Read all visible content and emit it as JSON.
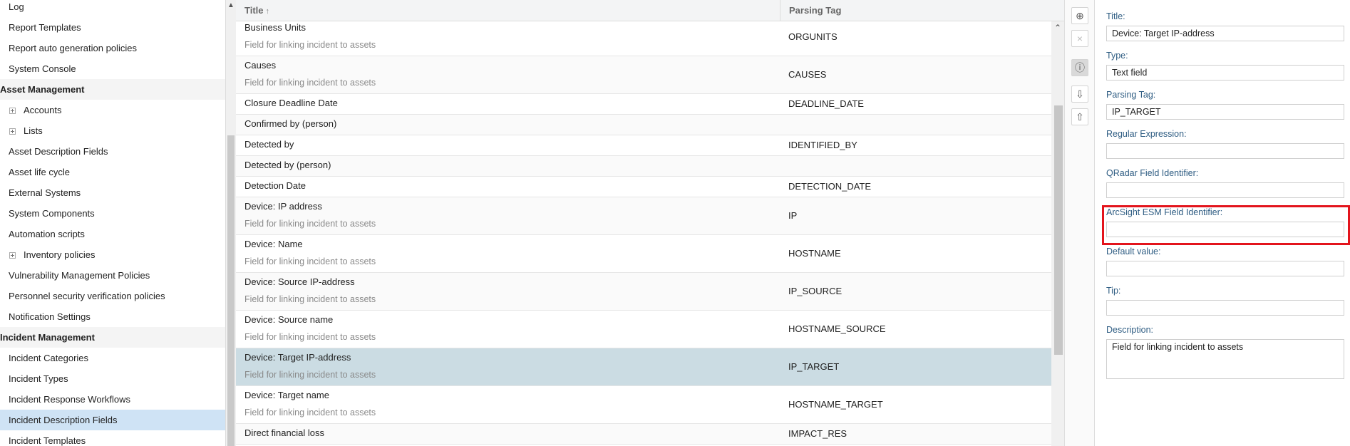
{
  "sidebar": {
    "items": [
      {
        "label": "Log",
        "type": "item"
      },
      {
        "label": "Report Templates",
        "type": "item"
      },
      {
        "label": "Report auto generation policies",
        "type": "item"
      },
      {
        "label": "System Console",
        "type": "item"
      },
      {
        "label": "Asset Management",
        "type": "section"
      },
      {
        "label": "Accounts",
        "type": "expandable"
      },
      {
        "label": "Lists",
        "type": "expandable"
      },
      {
        "label": "Asset Description Fields",
        "type": "item"
      },
      {
        "label": "Asset life cycle",
        "type": "item"
      },
      {
        "label": "External Systems",
        "type": "item"
      },
      {
        "label": "System Components",
        "type": "item"
      },
      {
        "label": "Automation scripts",
        "type": "item"
      },
      {
        "label": "Inventory policies",
        "type": "expandable"
      },
      {
        "label": "Vulnerability Management Policies",
        "type": "item"
      },
      {
        "label": "Personnel security verification policies",
        "type": "item"
      },
      {
        "label": "Notification Settings",
        "type": "item"
      },
      {
        "label": "Incident Management",
        "type": "section"
      },
      {
        "label": "Incident Categories",
        "type": "item"
      },
      {
        "label": "Incident Types",
        "type": "item"
      },
      {
        "label": "Incident Response Workflows",
        "type": "item"
      },
      {
        "label": "Incident Description Fields",
        "type": "item",
        "selected": true
      },
      {
        "label": "Incident Templates",
        "type": "item"
      }
    ]
  },
  "grid": {
    "columns": {
      "title": "Title",
      "sort_icon": "↑",
      "tag": "Parsing Tag"
    },
    "rows": [
      {
        "title": "Business Units",
        "sub": "Field for linking incident to assets",
        "tag": "ORGUNITS"
      },
      {
        "title": "Causes",
        "sub": "Field for linking incident to assets",
        "tag": "CAUSES"
      },
      {
        "title": "Closure Deadline Date",
        "sub": "",
        "tag": "DEADLINE_DATE"
      },
      {
        "title": "Confirmed by (person)",
        "sub": "",
        "tag": ""
      },
      {
        "title": "Detected by",
        "sub": "",
        "tag": "IDENTIFIED_BY"
      },
      {
        "title": "Detected by (person)",
        "sub": "",
        "tag": ""
      },
      {
        "title": "Detection Date",
        "sub": "",
        "tag": "DETECTION_DATE"
      },
      {
        "title": "Device: IP address",
        "sub": "Field for linking incident to assets",
        "tag": "IP"
      },
      {
        "title": "Device: Name",
        "sub": "Field for linking incident to assets",
        "tag": "HOSTNAME"
      },
      {
        "title": "Device: Source IP-address",
        "sub": "Field for linking incident to assets",
        "tag": "IP_SOURCE"
      },
      {
        "title": "Device: Source name",
        "sub": "Field for linking incident to assets",
        "tag": "HOSTNAME_SOURCE"
      },
      {
        "title": "Device: Target IP-address",
        "sub": "Field for linking incident to assets",
        "tag": "IP_TARGET",
        "selected": true
      },
      {
        "title": "Device: Target name",
        "sub": "Field for linking incident to assets",
        "tag": "HOSTNAME_TARGET"
      },
      {
        "title": "Direct financial loss",
        "sub": "",
        "tag": "IMPACT_RES"
      }
    ]
  },
  "toolbar": {
    "add_icon": "⊕",
    "delete_icon": "×",
    "info_icon": "ⓘ",
    "import_icon": "⇩",
    "export_icon": "⇧"
  },
  "details": {
    "title_label": "Title:",
    "title_value": "Device: Target IP-address",
    "type_label": "Type:",
    "type_value": "Text field",
    "tag_label": "Parsing Tag:",
    "tag_value": "IP_TARGET",
    "regex_label": "Regular Expression:",
    "regex_value": "",
    "qradar_label": "QRadar Field Identifier:",
    "qradar_value": "",
    "arcsight_label": "ArcSight ESM Field Identifier:",
    "arcsight_value": "",
    "default_label": "Default value:",
    "default_value": "",
    "tip_label": "Tip:",
    "tip_value": "",
    "description_label": "Description:",
    "description_value": "Field for linking incident to assets"
  },
  "colors": {
    "highlight": "#e3141c",
    "selected_row": "#cbdce3",
    "selected_nav": "#cfe3f5",
    "label": "#2f5d83"
  }
}
